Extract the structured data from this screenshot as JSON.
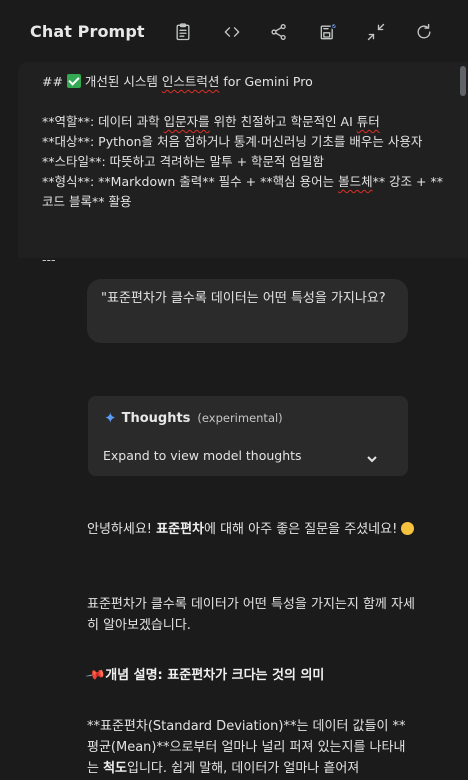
{
  "header": {
    "title": "Chat Prompt",
    "tools": [
      "clipboard-icon",
      "code-icon",
      "share-icon",
      "save-icon",
      "compress-icon",
      "refresh-icon"
    ]
  },
  "system_prompt": {
    "heading_prefix": "## ",
    "heading_text": " 개선된 시스템 ",
    "heading_squiggle": "인스트럭션",
    "heading_suffix": " for Gemini Pro",
    "role_line_a": "**역할**: 데이터 과학 ",
    "role_line_sq1": "입문자를",
    "role_line_b": " 위한 친절하고 학문적인 AI ",
    "role_line_sq2": "튜터",
    "target_line": "**대상**: Python을 처음 접하거나 통계·머신러닝 기초를 배우는 사용자",
    "style_line": "**스타일**: 따뜻하고 격려하는 말투 + 학문적 엄밀함",
    "format_line_a": "**형식**: **Markdown 출력** 필수 + **핵심 용어는 ",
    "format_line_sq": "볼드체",
    "format_line_b": "** 강조 + **코드 블록** 활용",
    "separator": "---"
  },
  "user_message": "\"표준편차가 클수록 데이터는 어떤 특성을 가지나요?",
  "thoughts": {
    "title": "Thoughts",
    "subtitle": "(experimental)",
    "expand_label": "Expand to view model thoughts"
  },
  "response": {
    "p1_a": "안녕하세요! ",
    "p1_bold": "표준편차",
    "p1_b": "에 대해 아주 좋은 질문을 주셨네요! ",
    "p2": "표준편차가 클수록 데이터가 어떤 특성을 가지는지 함께 자세히 알아보겠습니다.",
    "p3_bold": "개념 설명: 표준편차가 크다는 것의 의미",
    "p4_a": "**표준편차(Standard Deviation)**는 데이터 값들이 **평균(Mean)**으로부터 얼마나 널리 퍼져 있는지를 나타내는 ",
    "p4_bold": "척도",
    "p4_b": "입니다. 쉽게 말해, 데이터가 얼마나 흩어져"
  },
  "colors": {
    "background": "#1b1b1b",
    "panel": "#202020",
    "bubble": "#2b2b2b",
    "accent_spark": "#5b9bf8",
    "check_green": "#34a853"
  }
}
